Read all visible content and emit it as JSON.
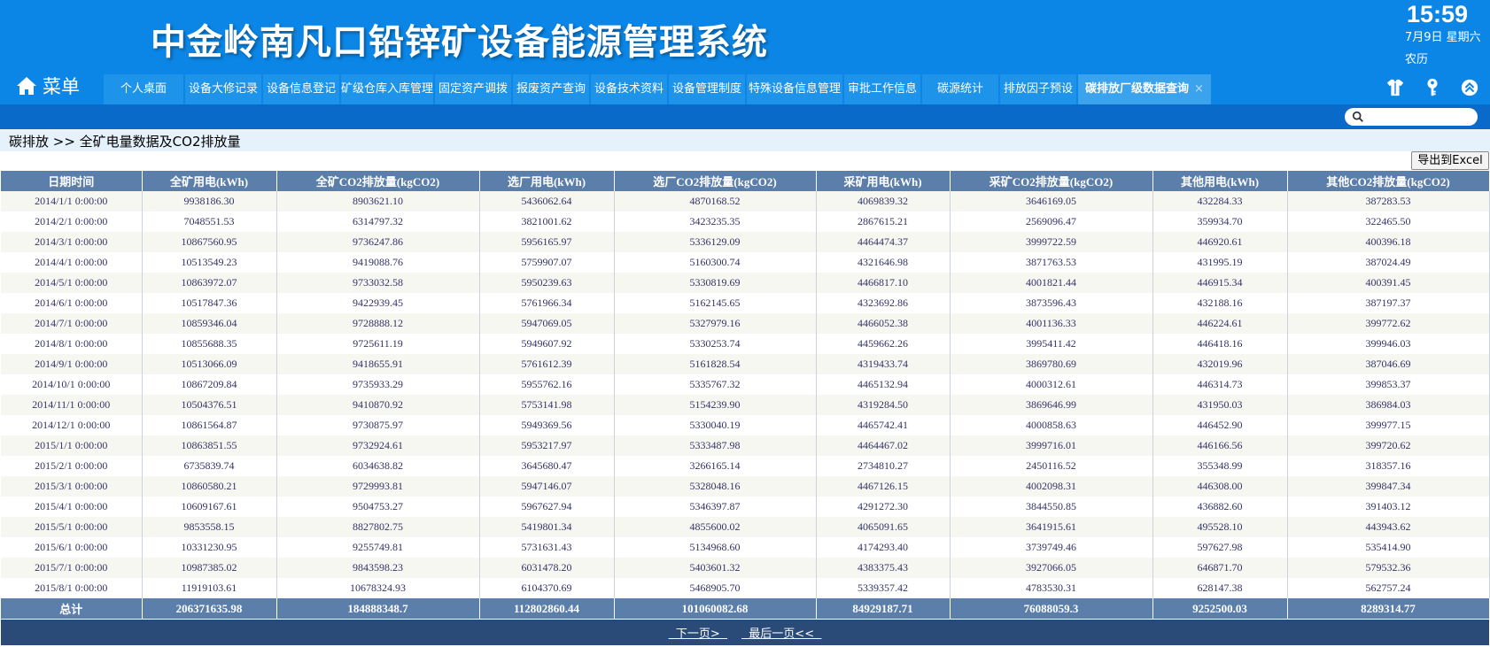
{
  "header": {
    "title": "中金岭南凡口铅锌矿设备能源管理系统",
    "clock": {
      "time": "15:59",
      "date": "7月9日 星期六",
      "lunar": "农历"
    },
    "menu_label": "菜单"
  },
  "tabs": [
    {
      "label": "个人桌面",
      "width": 90
    },
    {
      "label": "设备大修记录",
      "width": 86
    },
    {
      "label": "设备信息登记",
      "width": 86
    },
    {
      "label": "矿级仓库入库管理",
      "width": 104
    },
    {
      "label": "固定资产调拨",
      "width": 86
    },
    {
      "label": "报废资产查询",
      "width": 86
    },
    {
      "label": "设备技术资料",
      "width": 86
    },
    {
      "label": "设备管理制度",
      "width": 86
    },
    {
      "label": "特殊设备信息管理",
      "width": 108
    },
    {
      "label": "审批工作信息",
      "width": 86
    },
    {
      "label": "碳源统计",
      "width": 86
    },
    {
      "label": "排放因子预设",
      "width": 86
    },
    {
      "label": "碳排放厂级数据查询",
      "width": 150,
      "active": true,
      "close": "×"
    }
  ],
  "header_icons": [
    "clothing-icon",
    "key-icon",
    "collapse-up-icon"
  ],
  "search": {
    "placeholder": ""
  },
  "breadcrumb": "碳排放 >> 全矿电量数据及CO2排放量",
  "export_label": "导出到Excel",
  "table": {
    "columns": [
      {
        "label": "日期时间",
        "width": 159
      },
      {
        "label": "全矿用电(kWh)",
        "width": 152
      },
      {
        "label": "全矿CO2排放量(kgCO2)",
        "width": 229
      },
      {
        "label": "选厂用电(kWh)",
        "width": 152
      },
      {
        "label": "选厂CO2排放量(kgCO2)",
        "width": 228
      },
      {
        "label": "采矿用电(kWh)",
        "width": 151
      },
      {
        "label": "采矿CO2排放量(kgCO2)",
        "width": 229
      },
      {
        "label": "其他用电(kWh)",
        "width": 152
      },
      {
        "label": "其他CO2排放量(kgCO2)",
        "width": 228
      }
    ],
    "rows": [
      [
        "2014/1/1 0:00:00",
        "9938186.30",
        "8903621.10",
        "5436062.64",
        "4870168.52",
        "4069839.32",
        "3646169.05",
        "432284.33",
        "387283.53"
      ],
      [
        "2014/2/1 0:00:00",
        "7048551.53",
        "6314797.32",
        "3821001.62",
        "3423235.35",
        "2867615.21",
        "2569096.47",
        "359934.70",
        "322465.50"
      ],
      [
        "2014/3/1 0:00:00",
        "10867560.95",
        "9736247.86",
        "5956165.97",
        "5336129.09",
        "4464474.37",
        "3999722.59",
        "446920.61",
        "400396.18"
      ],
      [
        "2014/4/1 0:00:00",
        "10513549.23",
        "9419088.76",
        "5759907.07",
        "5160300.74",
        "4321646.98",
        "3871763.53",
        "431995.19",
        "387024.49"
      ],
      [
        "2014/5/1 0:00:00",
        "10863972.07",
        "9733032.58",
        "5950239.63",
        "5330819.69",
        "4466817.10",
        "4001821.44",
        "446915.34",
        "400391.45"
      ],
      [
        "2014/6/1 0:00:00",
        "10517847.36",
        "9422939.45",
        "5761966.34",
        "5162145.65",
        "4323692.86",
        "3873596.43",
        "432188.16",
        "387197.37"
      ],
      [
        "2014/7/1 0:00:00",
        "10859346.04",
        "9728888.12",
        "5947069.05",
        "5327979.16",
        "4466052.38",
        "4001136.33",
        "446224.61",
        "399772.62"
      ],
      [
        "2014/8/1 0:00:00",
        "10855688.35",
        "9725611.19",
        "5949607.92",
        "5330253.74",
        "4459662.26",
        "3995411.42",
        "446418.16",
        "399946.03"
      ],
      [
        "2014/9/1 0:00:00",
        "10513066.09",
        "9418655.91",
        "5761612.39",
        "5161828.54",
        "4319433.74",
        "3869780.69",
        "432019.96",
        "387046.69"
      ],
      [
        "2014/10/1 0:00:00",
        "10867209.84",
        "9735933.29",
        "5955762.16",
        "5335767.32",
        "4465132.94",
        "4000312.61",
        "446314.73",
        "399853.37"
      ],
      [
        "2014/11/1 0:00:00",
        "10504376.51",
        "9410870.92",
        "5753141.98",
        "5154239.90",
        "4319284.50",
        "3869646.99",
        "431950.03",
        "386984.03"
      ],
      [
        "2014/12/1 0:00:00",
        "10861564.87",
        "9730875.97",
        "5949369.56",
        "5330040.19",
        "4465742.41",
        "4000858.63",
        "446452.90",
        "399977.15"
      ],
      [
        "2015/1/1 0:00:00",
        "10863851.55",
        "9732924.61",
        "5953217.97",
        "5333487.98",
        "4464467.02",
        "3999716.01",
        "446166.56",
        "399720.62"
      ],
      [
        "2015/2/1 0:00:00",
        "6735839.74",
        "6034638.82",
        "3645680.47",
        "3266165.14",
        "2734810.27",
        "2450116.52",
        "355348.99",
        "318357.16"
      ],
      [
        "2015/3/1 0:00:00",
        "10860580.21",
        "9729993.81",
        "5947146.07",
        "5328048.16",
        "4467126.15",
        "4002098.31",
        "446308.00",
        "399847.34"
      ],
      [
        "2015/4/1 0:00:00",
        "10609167.61",
        "9504753.27",
        "5967627.94",
        "5346397.87",
        "4291272.30",
        "3844550.85",
        "436882.60",
        "391403.12"
      ],
      [
        "2015/5/1 0:00:00",
        "9853558.15",
        "8827802.75",
        "5419801.34",
        "4855600.02",
        "4065091.65",
        "3641915.61",
        "495528.10",
        "443943.62"
      ],
      [
        "2015/6/1 0:00:00",
        "10331230.95",
        "9255749.81",
        "5731631.43",
        "5134968.60",
        "4174293.40",
        "3739749.46",
        "597627.98",
        "535414.90"
      ],
      [
        "2015/7/1 0:00:00",
        "10987385.02",
        "9843598.23",
        "6031478.20",
        "5403601.32",
        "4383375.43",
        "3927066.05",
        "646871.70",
        "579532.36"
      ],
      [
        "2015/8/1 0:00:00",
        "11919103.61",
        "10678324.93",
        "6104370.69",
        "5468905.70",
        "5339357.42",
        "4783530.31",
        "628147.38",
        "562757.24"
      ]
    ],
    "total": [
      "总计",
      "206371635.98",
      "184888348.7",
      "112802860.44",
      "101060082.68",
      "84929187.71",
      "76088059.3",
      "9252500.03",
      "8289314.77"
    ]
  },
  "pager": {
    "next": "  下一页>  ",
    "last": "  最后一页<<  "
  }
}
